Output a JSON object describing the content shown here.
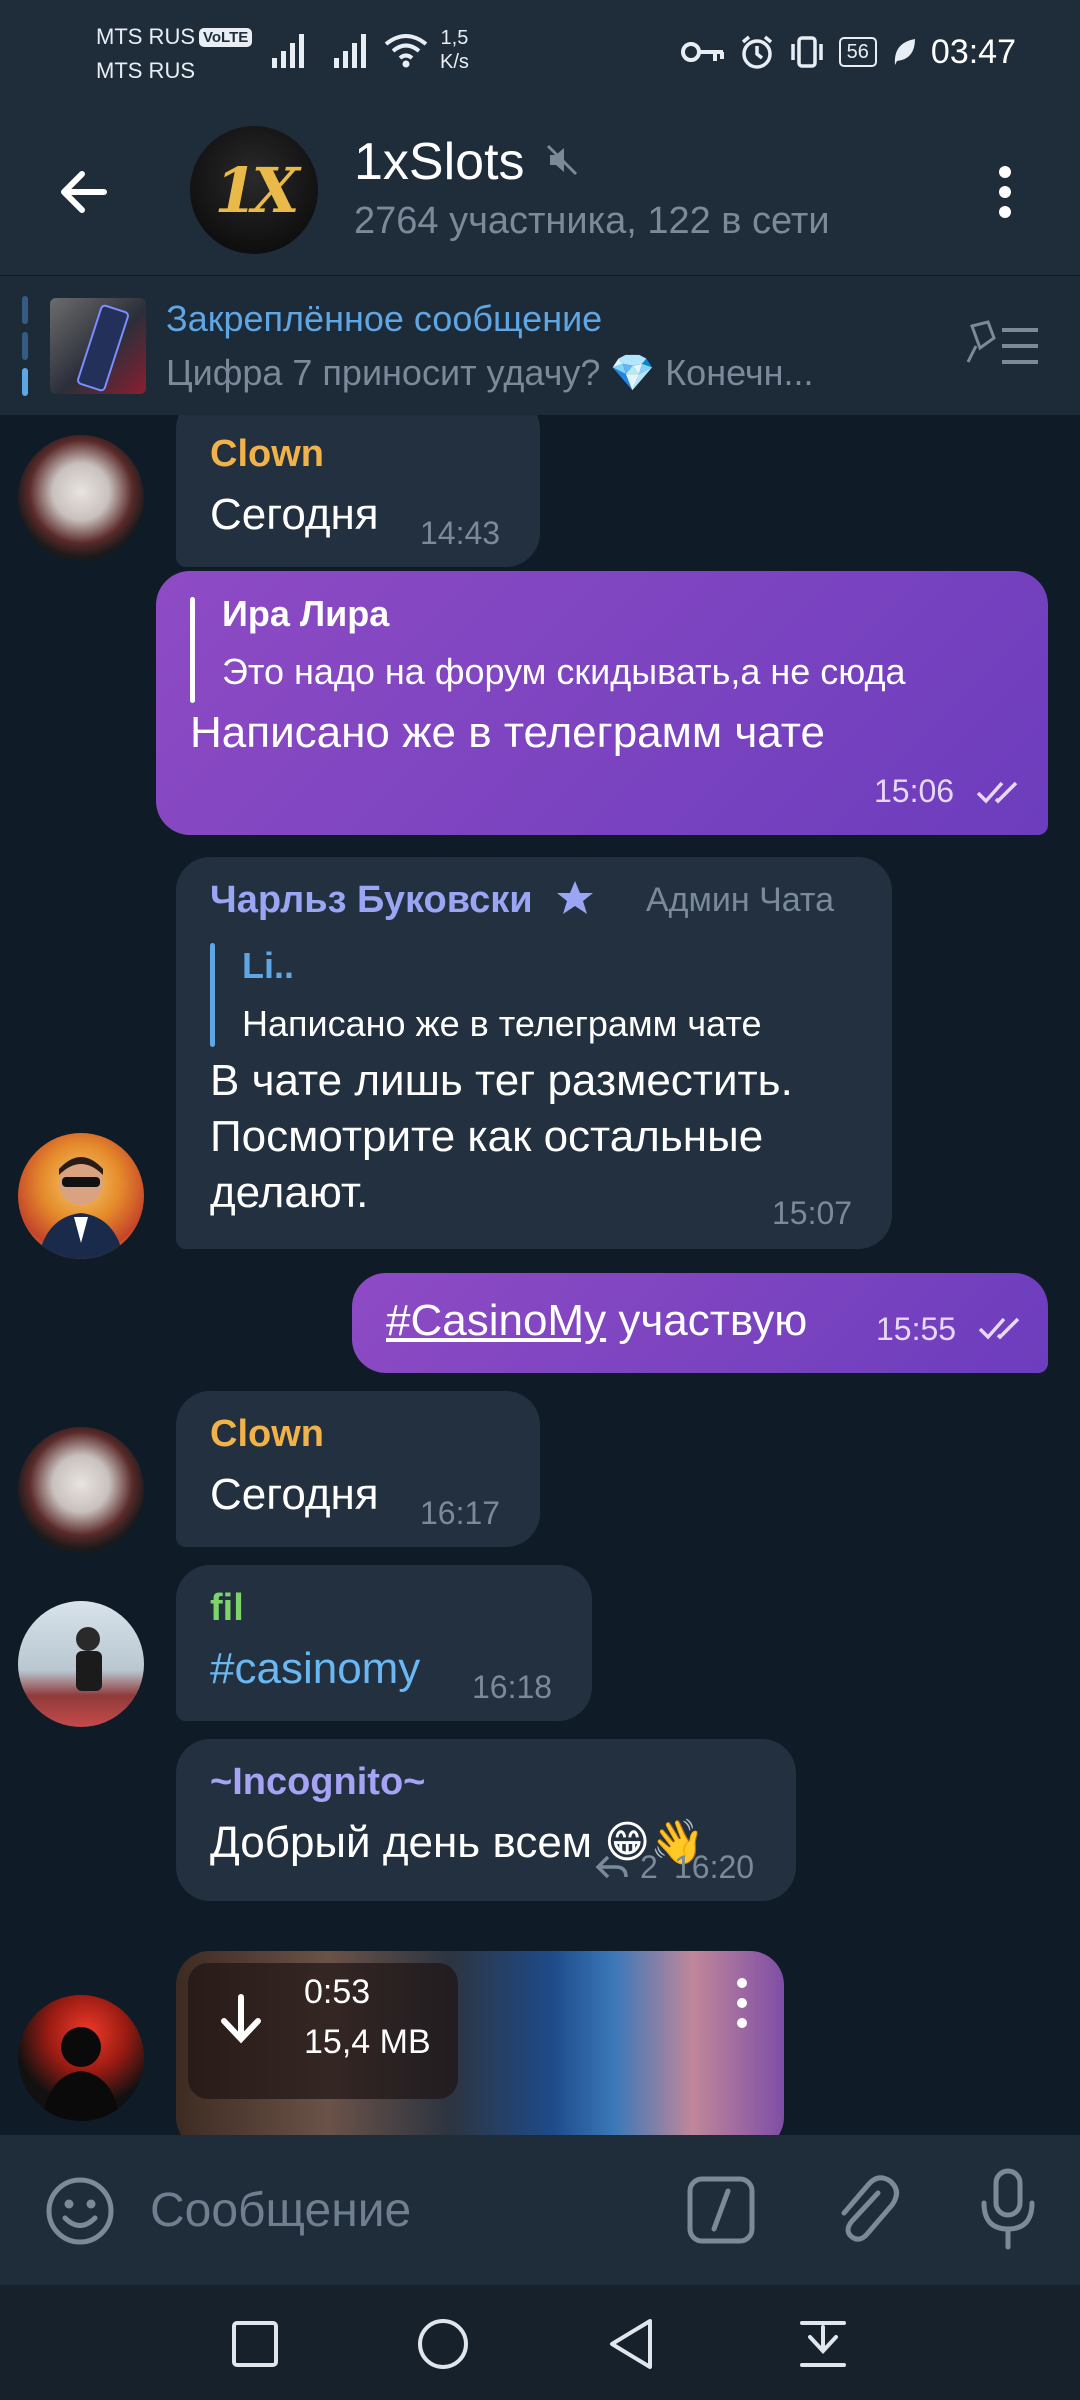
{
  "status": {
    "carrier1": "MTS RUS",
    "volte": "VoLTE",
    "carrier2": "MTS RUS",
    "net_speed_value": "1,5",
    "net_speed_unit": "K/s",
    "battery": "56",
    "time": "03:47"
  },
  "header": {
    "title": "1xSlots",
    "subtitle": "2764 участника, 122 в сети",
    "avatar_text": "1X"
  },
  "pinned": {
    "title": "Закреплённое сообщение",
    "text": "Цифра 7 приносит удачу? 💎 Конечн..."
  },
  "messages": [
    {
      "sender": "Clown",
      "text": "Сегодня",
      "time": "14:43"
    },
    {
      "reply_to": "Ира Лира",
      "reply_text": "Это надо на форум скидывать,а не сюда",
      "text": "Написано же в телеграмм чате",
      "time": "15:06"
    },
    {
      "sender": "Чарльз Буковски",
      "badge": "Админ Чата",
      "reply_to": "Li..",
      "reply_text": "Написано же в телеграмм чате",
      "text_lines": [
        "В чате лишь тег разместить.",
        "Посмотрите как остальные",
        "делают."
      ],
      "time": "15:07"
    },
    {
      "hashtag": "#CasinoMy",
      "text": " участвую",
      "time": "15:55"
    },
    {
      "sender": "Clown",
      "text": "Сегодня",
      "time": "16:17"
    },
    {
      "sender": "fil",
      "text": "#casinomy",
      "time": "16:18"
    },
    {
      "sender": "~Incognito~",
      "text": "Добрый день всем 😁👋",
      "replies": "2",
      "time": "16:20"
    },
    {
      "video_duration": "0:53",
      "video_size": "15,4 MB"
    }
  ],
  "composer": {
    "placeholder": "Сообщение"
  },
  "colors": {
    "accent": "#5ea6e4",
    "outgoing_bubble": "#8e4bc4",
    "incoming_bubble": "#223040",
    "clown_name": "#f2b24a",
    "admin_name": "#9aa6f4",
    "fil_name": "#7ed46a",
    "incognito_name": "#a6a3f5"
  }
}
